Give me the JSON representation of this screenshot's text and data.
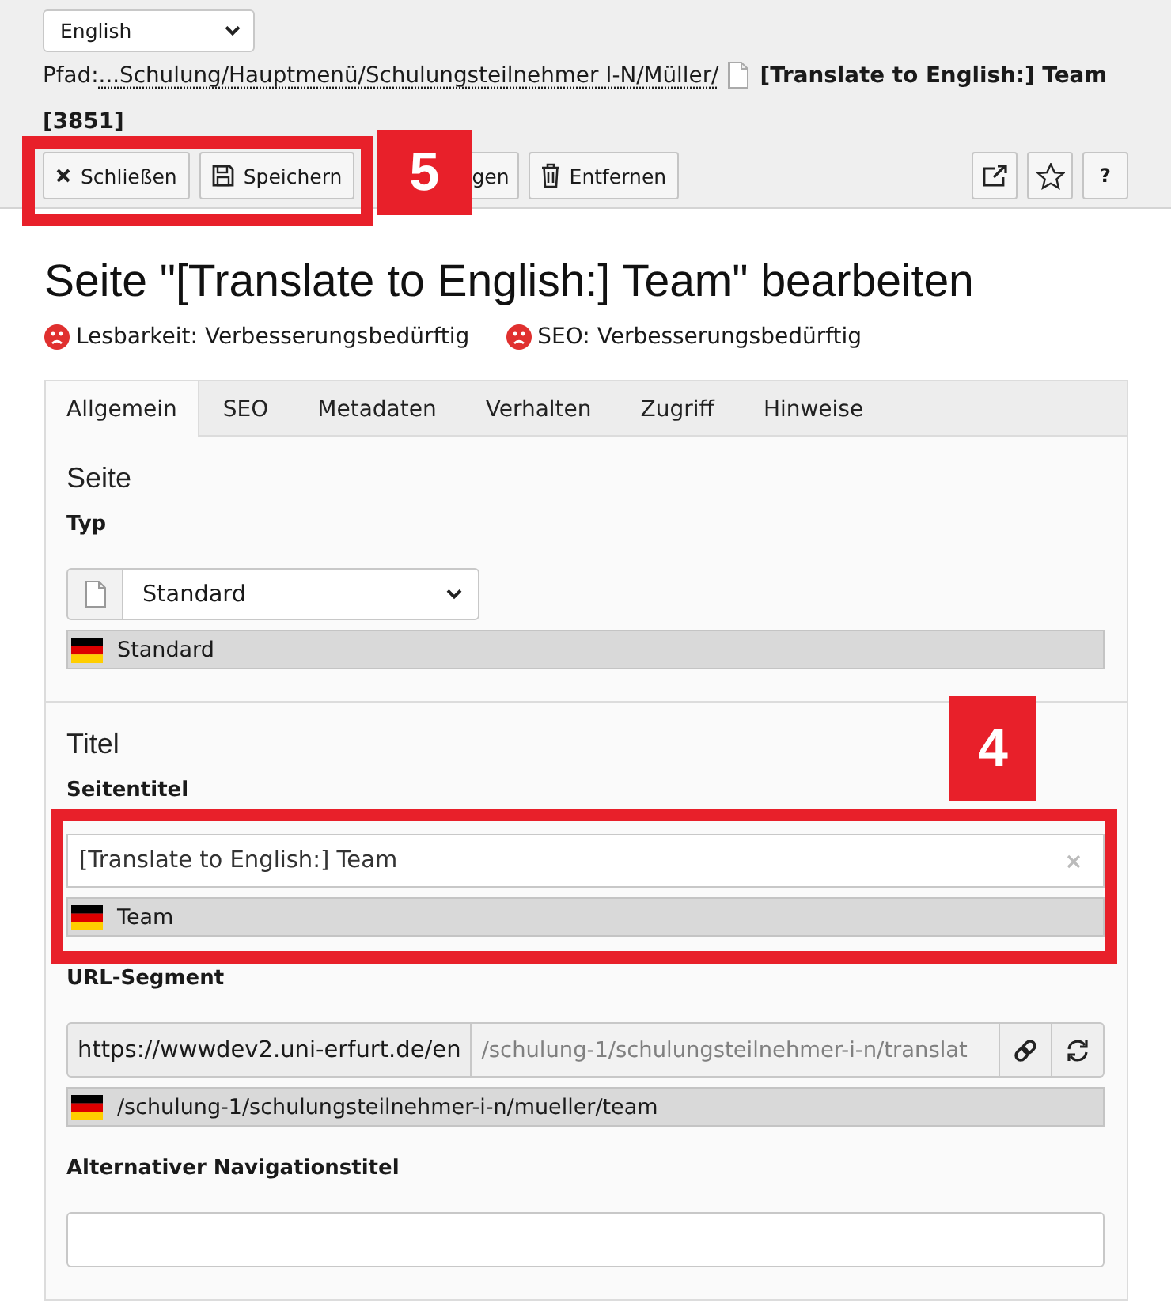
{
  "language_select": {
    "value": "English"
  },
  "path": {
    "label": "Pfad:",
    "link": "...Schulung/Hauptmenü/Schulungsteilnehmer I-N/Müller/",
    "page_title": "[Translate to English:] Team",
    "page_id": "[3851]"
  },
  "toolbar": {
    "callout": "5",
    "buttons": [
      {
        "kind": "close",
        "label": "Schließen",
        "highlighted": true
      },
      {
        "kind": "save",
        "label": "Speichern",
        "highlighted": true
      },
      {
        "kind": "covered",
        "label": "gen",
        "highlighted": false
      },
      {
        "kind": "delete",
        "label": "Entfernen",
        "highlighted": false
      }
    ],
    "right_buttons": [
      {
        "kind": "open"
      },
      {
        "kind": "bookmark"
      },
      {
        "kind": "help",
        "label": "?"
      }
    ]
  },
  "heading": "Seite \"[Translate to English:] Team\" bearbeiten",
  "ratings": [
    {
      "label": "Lesbarkeit: Verbesserungsbedürftig",
      "kind": "sad"
    },
    {
      "label": "SEO: Verbesserungsbedürftig",
      "kind": "sad"
    }
  ],
  "tabs": [
    {
      "label": "Allgemein",
      "selected": true
    },
    {
      "label": "SEO",
      "selected": false
    },
    {
      "label": "Metadaten",
      "selected": false
    },
    {
      "label": "Verhalten",
      "selected": false
    },
    {
      "label": "Zugriff",
      "selected": false
    },
    {
      "label": "Hinweise",
      "selected": false
    }
  ],
  "sections": [
    {
      "title": "Seite",
      "fields": [
        {
          "kind": "select",
          "label": "Typ",
          "value": "Standard",
          "source": "Standard"
        }
      ]
    },
    {
      "title": "Titel",
      "fields": [
        {
          "kind": "text",
          "label": "Seitentitel",
          "value": "[Translate to English:] Team",
          "clearable": true,
          "source": "Team",
          "callout": "4"
        },
        {
          "kind": "url",
          "label": "URL-Segment",
          "prefix": "https://wwwdev2.uni-erfurt.de/en",
          "value": "/schulung-1/schulungsteilnehmer-i-n/translat",
          "readonly": true,
          "source": "/schulung-1/schulungsteilnehmer-i-n/mueller/team"
        },
        {
          "kind": "text",
          "label": "Alternativer Navigationstitel"
        }
      ]
    }
  ]
}
